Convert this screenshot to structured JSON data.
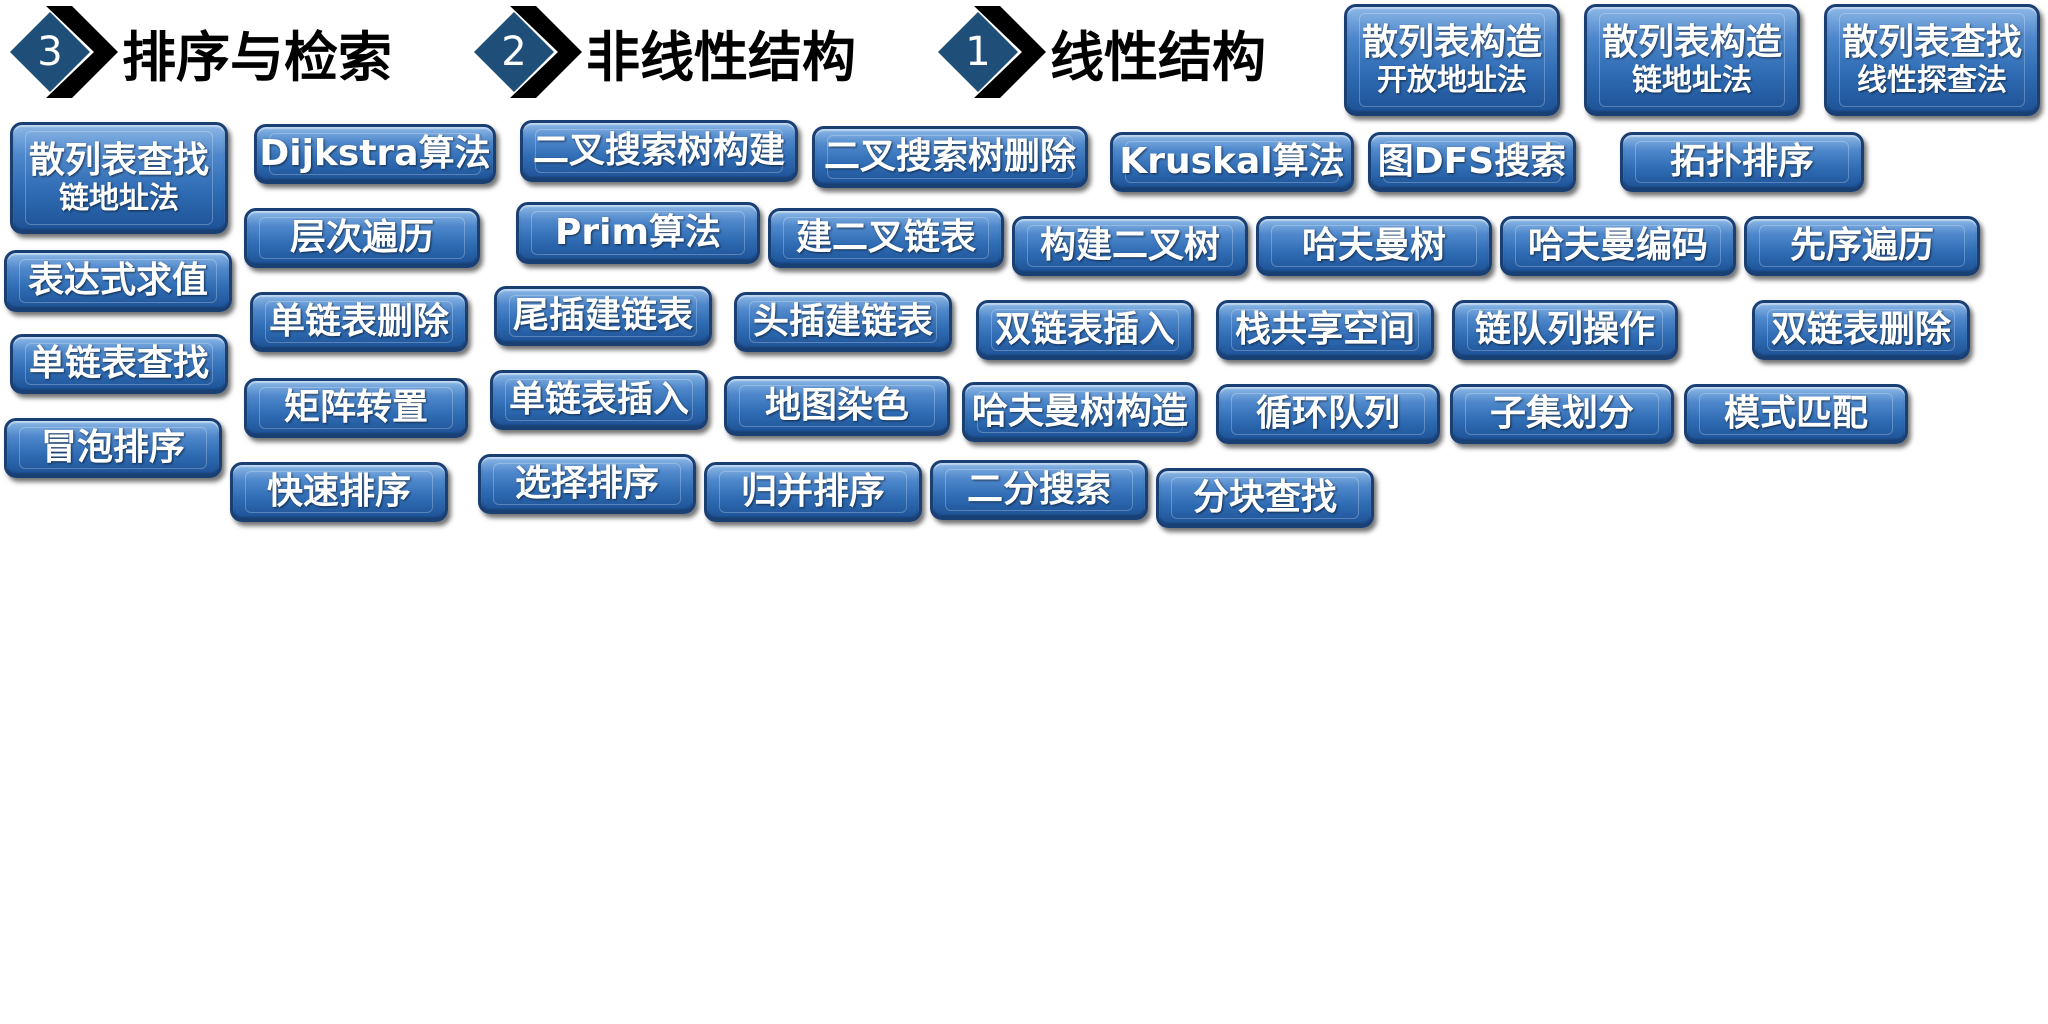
{
  "sections": [
    {
      "number": "3",
      "title": "排序与检索"
    },
    {
      "number": "2",
      "title": "非线性结构"
    },
    {
      "number": "1",
      "title": "线性结构"
    }
  ],
  "buttons": [
    {
      "label": "散列表构造",
      "sublabel": "开放地址法"
    },
    {
      "label": "散列表构造",
      "sublabel": "链地址法"
    },
    {
      "label": "散列表查找",
      "sublabel": "线性探查法"
    },
    {
      "label": "散列表查找",
      "sublabel": "链地址法"
    },
    {
      "label": "Dijkstra算法"
    },
    {
      "label": "二叉搜索树构建"
    },
    {
      "label": "二叉搜索树删除"
    },
    {
      "label": "Kruskal算法"
    },
    {
      "label": "图DFS搜索"
    },
    {
      "label": "拓扑排序"
    },
    {
      "label": "层次遍历"
    },
    {
      "label": "Prim算法"
    },
    {
      "label": "建二叉链表"
    },
    {
      "label": "构建二叉树"
    },
    {
      "label": "哈夫曼树"
    },
    {
      "label": "哈夫曼编码"
    },
    {
      "label": "先序遍历"
    },
    {
      "label": "表达式求值"
    },
    {
      "label": "单链表删除"
    },
    {
      "label": "尾插建链表"
    },
    {
      "label": "头插建链表"
    },
    {
      "label": "双链表插入"
    },
    {
      "label": "栈共享空间"
    },
    {
      "label": "链队列操作"
    },
    {
      "label": "双链表删除"
    },
    {
      "label": "单链表查找"
    },
    {
      "label": "矩阵转置"
    },
    {
      "label": "单链表插入"
    },
    {
      "label": "地图染色"
    },
    {
      "label": "哈夫曼树构造"
    },
    {
      "label": "循环队列"
    },
    {
      "label": "子集划分"
    },
    {
      "label": "模式匹配"
    },
    {
      "label": "冒泡排序"
    },
    {
      "label": "快速排序"
    },
    {
      "label": "选择排序"
    },
    {
      "label": "归并排序"
    },
    {
      "label": "二分搜索"
    },
    {
      "label": "分块查找"
    }
  ]
}
